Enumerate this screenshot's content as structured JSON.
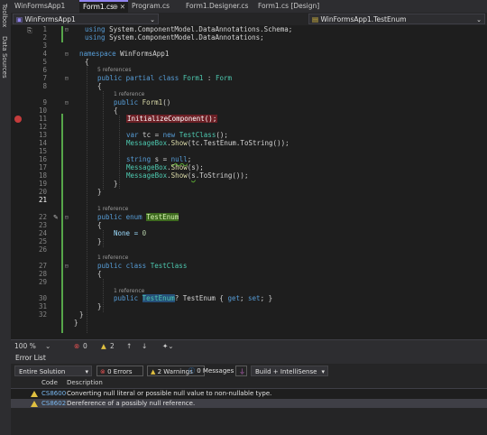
{
  "side_tabs": [
    "Toolbox",
    "Data Sources"
  ],
  "tabs": [
    {
      "label": "WinFormsApp1"
    },
    {
      "label": "Form1.cs",
      "close": "✕",
      "pin": "⊕"
    },
    {
      "label": "Program.cs"
    },
    {
      "label": "Form1.Designer.cs"
    },
    {
      "label": "Form1.cs [Design]"
    }
  ],
  "nav": {
    "project": "WinFormsApp1",
    "type": "WinFormsApp1.TestEnum"
  },
  "code_lines": [
    {
      "n": "1"
    },
    {
      "n": "2"
    },
    {
      "n": "3"
    },
    {
      "n": "4"
    },
    {
      "n": "5"
    },
    {
      "n": "6"
    },
    {
      "n": "7"
    },
    {
      "n": "8"
    },
    {
      "n": "9"
    },
    {
      "n": "10"
    },
    {
      "n": "11"
    },
    {
      "n": "12"
    },
    {
      "n": "13"
    },
    {
      "n": "14"
    },
    {
      "n": "15"
    },
    {
      "n": "16"
    },
    {
      "n": "17"
    },
    {
      "n": "18"
    },
    {
      "n": "19"
    },
    {
      "n": "20"
    },
    {
      "n": "21"
    },
    {
      "n": "22"
    },
    {
      "n": "23"
    },
    {
      "n": "24"
    },
    {
      "n": "25"
    },
    {
      "n": "26"
    },
    {
      "n": "27"
    },
    {
      "n": "28"
    },
    {
      "n": "29"
    },
    {
      "n": "30"
    },
    {
      "n": "31"
    },
    {
      "n": "32"
    }
  ],
  "code": {
    "l1_using": "using",
    "l1_ns": " System.ComponentModel.DataAnnotations.Schema;",
    "l2_using": "using",
    "l2_ns": " System.ComponentModel.DataAnnotations;",
    "l4_ns_kw": "namespace",
    "l4_ns": " WinFormsApp1",
    "l5": "{",
    "ref_5": "5 references",
    "l6_kw": "public partial class",
    "l6_ty": "Form1",
    "l6_rest": " : ",
    "l6_base": "Form",
    "l7": "{",
    "ref_1a": "1 reference",
    "l8_kw": "public",
    "l8_me": "Form1",
    "l8_rest": "()",
    "l9": "{",
    "l10": "InitializeComponent();",
    "l12_kw": "var",
    "l12_a": " tc = ",
    "l12_new": "new",
    "l12_ty": " TestClass",
    "l12_b": "();",
    "l13_ty": "MessageBox",
    "l13_a": ".",
    "l13_me": "Show",
    "l13_b": "(tc.TestEnum.ToString());",
    "l15_kw": "string",
    "l15_a": " s = ",
    "l15_null": "null",
    "l15_b": ";",
    "l16_ty": "MessageBox",
    "l16_a": ".",
    "l16_me": "Show",
    "l16_b": "(s);",
    "l17_ty": "MessageBox",
    "l17_a": ".",
    "l17_me": "Show",
    "l17_b": "(",
    "l17_s": "s",
    "l17_c": ".ToString());",
    "l18": "}",
    "l19": "}",
    "ref_1b": "1 reference",
    "l21_kw": "public enum",
    "l21_ty": "TestEnum",
    "l22": "{",
    "l23_a": "None = ",
    "l23_n": "0",
    "l24": "}",
    "ref_1c": "1 reference",
    "l26_kw": "public class",
    "l26_ty": "TestClass",
    "l27": "{",
    "ref_1d": "1 reference",
    "l29_kw": "public",
    "l29_ty": "TestEnum",
    "l29_a": "? TestEnum { ",
    "l29_get": "get",
    "l29_b": "; ",
    "l29_set": "set",
    "l29_c": "; }",
    "l30": "}",
    "l31": "}",
    "l32": "}"
  },
  "status": {
    "zoom": "100 %",
    "errors": "0",
    "warnings": "2",
    "up": "↑",
    "down": "↓"
  },
  "error_list": {
    "title": "Error List",
    "scope": "Entire Solution",
    "errors_btn": "0 Errors",
    "warnings_btn": "2 Warnings",
    "messages_btn": "0 Messages",
    "build_filter": "Build + IntelliSense",
    "col_code": "Code",
    "col_desc": "Description",
    "rows": [
      {
        "code": "CS8600",
        "desc": "Converting null literal or possible null value to non-nullable type."
      },
      {
        "code": "CS8602",
        "desc": "Dereference of a possibly null reference."
      }
    ]
  },
  "colors": {
    "accent": "#9184ee",
    "breakpoint": "#c43c3c",
    "change_bar": "#57a64a",
    "warning": "#e0c040"
  }
}
